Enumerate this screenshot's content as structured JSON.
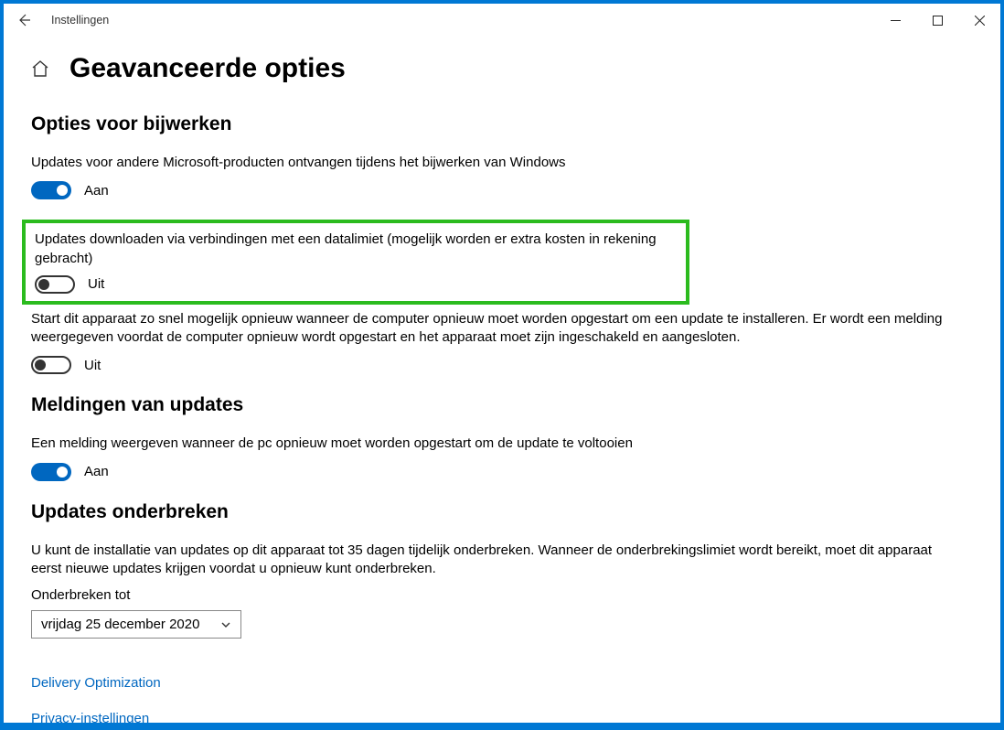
{
  "titlebar": {
    "app_name": "Instellingen"
  },
  "header": {
    "page_title": "Geavanceerde opties"
  },
  "sections": {
    "update_options": {
      "title": "Opties voor bijwerken",
      "opt1": {
        "text": "Updates voor andere Microsoft-producten ontvangen tijdens het bijwerken van Windows",
        "state": "Aan"
      },
      "opt2": {
        "text": "Updates downloaden via verbindingen met een datalimiet (mogelijk worden er extra kosten in rekening gebracht)",
        "state": "Uit"
      },
      "opt3": {
        "text": "Start dit apparaat zo snel mogelijk opnieuw wanneer de computer opnieuw moet worden opgestart om een update te installeren. Er wordt een melding weergegeven voordat de computer opnieuw wordt opgestart en het apparaat moet zijn ingeschakeld en aangesloten.",
        "state": "Uit"
      }
    },
    "notifications": {
      "title": "Meldingen van updates",
      "opt1": {
        "text": "Een melding weergeven wanneer de pc opnieuw moet worden opgestart om de update te voltooien",
        "state": "Aan"
      }
    },
    "pause": {
      "title": "Updates onderbreken",
      "description": "U kunt de installatie van updates op dit apparaat tot 35 dagen tijdelijk onderbreken. Wanneer de onderbrekingslimiet wordt bereikt, moet dit apparaat eerst nieuwe updates krijgen voordat u opnieuw kunt onderbreken.",
      "label": "Onderbreken tot",
      "selected": "vrijdag 25 december 2020"
    }
  },
  "links": {
    "delivery": "Delivery Optimization",
    "privacy": "Privacy-instellingen"
  }
}
